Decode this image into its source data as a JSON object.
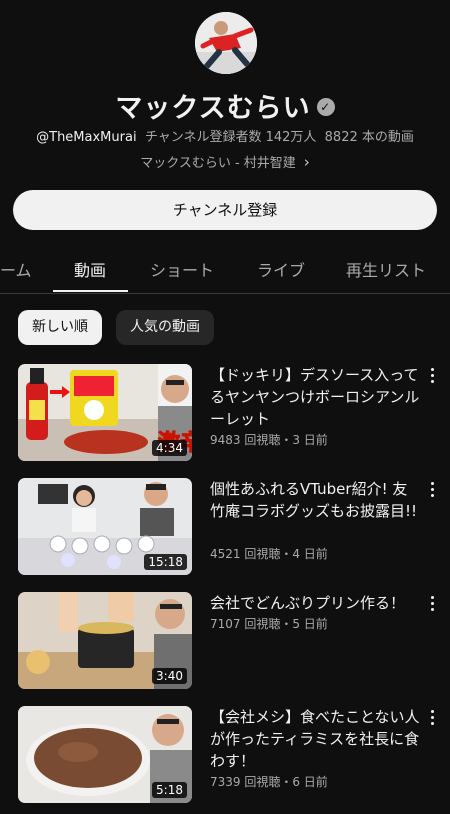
{
  "channel": {
    "name": "マックスむらい",
    "verified_icon": "check-circle-icon",
    "handle": "@TheMaxMurai",
    "subscribers_text": "チャンネル登録者数 142万人",
    "videos_text": "8822 本の動画",
    "link_text": "マックスむらい - 村井智建",
    "link_icon": "chevron-right-icon",
    "subscribe_label": "チャンネル登録"
  },
  "tabs": [
    "ーム",
    "動画",
    "ショート",
    "ライブ",
    "再生リスト"
  ],
  "active_tab": "動画",
  "chips": [
    "新しい順",
    "人気の動画"
  ],
  "videos": [
    {
      "title": "【ドッキリ】デスソース入ってるヤンヤンつけボーロシアンルーレット",
      "meta": "9483 回視聴・3 日前",
      "duration": "4:34",
      "thumb_text": "激辛"
    },
    {
      "title": "個性あふれるVTuber紹介! 友竹庵コラボグッズもお披露目!!",
      "meta": "4521 回視聴・4 日前",
      "duration": "15:18"
    },
    {
      "title": "会社でどんぶりプリン作る！",
      "meta": "7107 回視聴・5 日前",
      "duration": "3:40"
    },
    {
      "title": "【会社メシ】食べたことない人が作ったティラミスを社長に食わす！",
      "meta": "7339 回視聴・6 日前",
      "duration": "5:18"
    }
  ],
  "colors": {
    "background": "#0f0f0f",
    "text_primary": "#f1f1f1",
    "text_secondary": "#aaaaaa",
    "chip_inactive": "#272727"
  }
}
